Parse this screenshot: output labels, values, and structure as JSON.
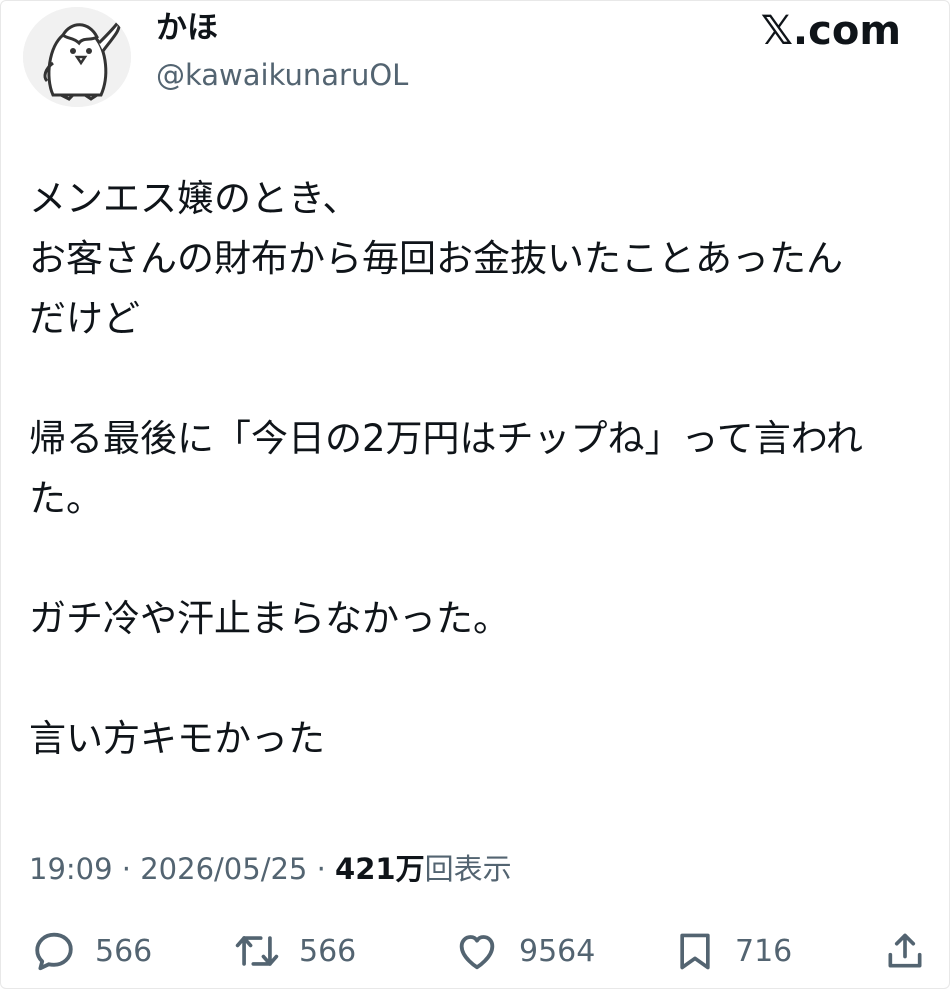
{
  "user": {
    "display_name": "かほ",
    "handle": "@kawaikunaruOL",
    "avatar_icon": "penguin-avatar-icon"
  },
  "brand": {
    "label": "𝕏.com"
  },
  "tweet": {
    "lines": [
      "メンエス嬢のとき、",
      "お客さんの財布から毎回お金抜いたことあったん",
      "だけど",
      "",
      "帰る最後に「今日の2万円はチップね」って言われ",
      "た。",
      "",
      "ガチ冷や汗止まらなかった。",
      "",
      "言い方キモかった"
    ]
  },
  "meta": {
    "time": "19:09",
    "separator": " · ",
    "date": "2026/05/25",
    "views_count": "421万",
    "views_label": "回表示"
  },
  "actions": {
    "reply": {
      "icon": "reply-icon",
      "count": "566"
    },
    "repost": {
      "icon": "repost-icon",
      "count": "566"
    },
    "like": {
      "icon": "heart-icon",
      "count": "9564"
    },
    "bookmark": {
      "icon": "bookmark-icon",
      "count": "716"
    },
    "share": {
      "icon": "share-icon"
    }
  },
  "colors": {
    "text_primary": "#0f1419",
    "text_secondary": "#536471",
    "background": "#ffffff"
  }
}
